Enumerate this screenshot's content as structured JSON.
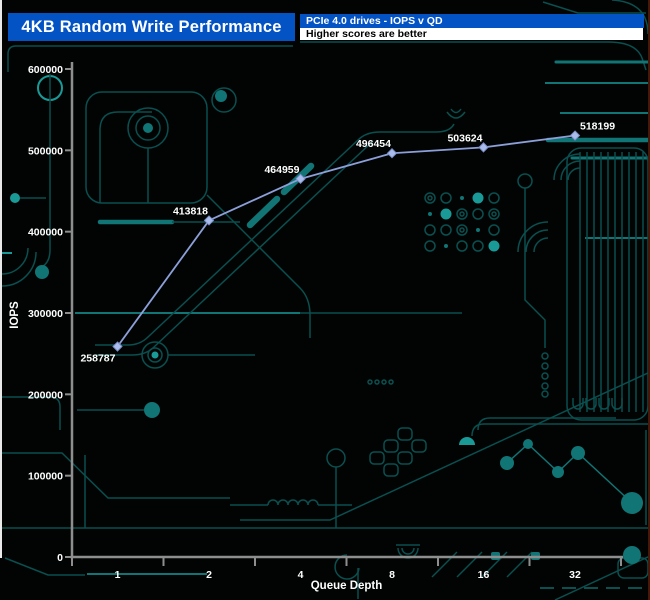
{
  "header": {
    "title": "4KB Random Write Performance",
    "subtitle_top": "PCIe 4.0 drives - IOPS v QD",
    "subtitle_bottom": "Higher scores are better"
  },
  "chart_data": {
    "type": "line",
    "title": "4KB Random Write Performance",
    "categories": [
      "1",
      "2",
      "4",
      "8",
      "16",
      "32"
    ],
    "values": [
      258787,
      413818,
      464959,
      496454,
      503624,
      518199
    ],
    "xlabel": "Queue Depth",
    "ylabel": "IOPS",
    "ylim": [
      0,
      600000
    ],
    "yticks": [
      0,
      100000,
      200000,
      300000,
      400000,
      500000,
      600000
    ],
    "grid": false,
    "legend": "none",
    "marker": "diamond",
    "point_labels_visible": true,
    "background_style": "dark circuit board"
  },
  "colors": {
    "header_blue": "#0353C4",
    "header_text": "#FFFFFF",
    "subtitle_bg_white": "#FFFFFF",
    "subtitle_text_black": "#000000",
    "background": "#020404",
    "circuit_teal_dark": "#0B4F4F",
    "circuit_teal_mid": "#117575",
    "circuit_teal_bright": "#1A9A97",
    "axis_gray": "#8E8E8E",
    "line": "#8C9FD8",
    "marker": "#A9BCEC",
    "marker_edge": "#7C90C8",
    "label_white": "#FFFFFF"
  }
}
